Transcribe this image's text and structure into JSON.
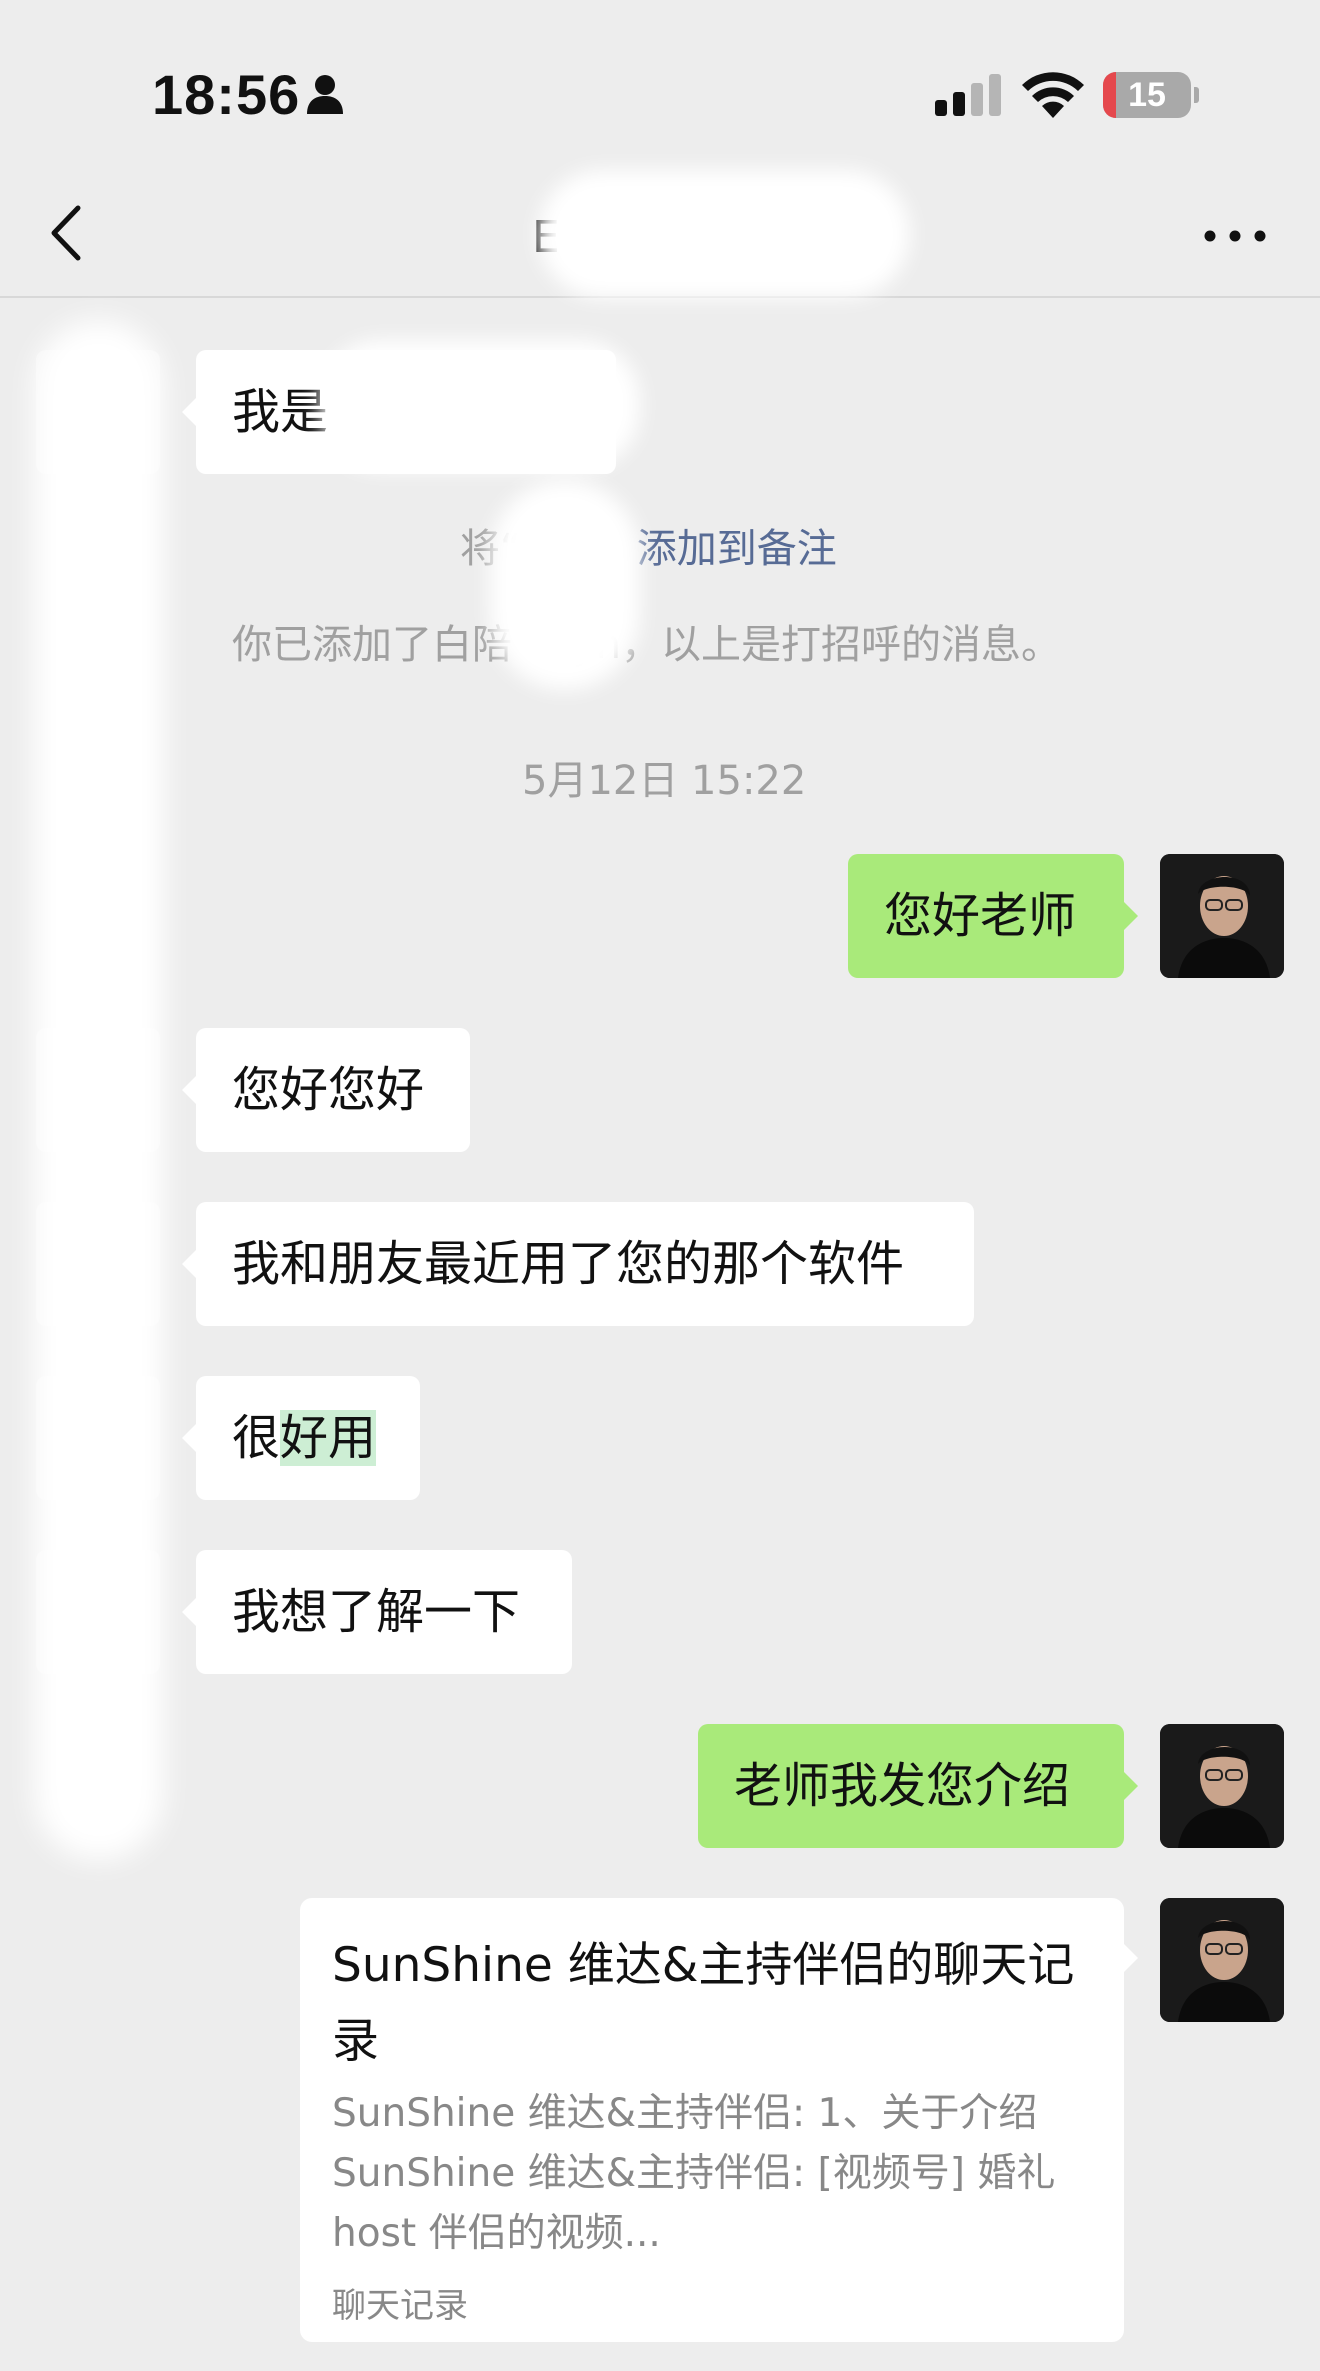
{
  "status_bar": {
    "time": "18:56",
    "battery": "15",
    "battery_level": 0.15
  },
  "header": {
    "back_icon": "chevron-left-icon",
    "title": "E",
    "more_icon": "more-dots-icon"
  },
  "messages": {
    "m1": "我是",
    "remark_prefix": "将“",
    "remark_link": "添加到备注",
    "added_notice": "你已添加了白陪",
    "added_notice_tail": "yn，以上是打招呼的消息。",
    "timestamp": "5月12日 15:22",
    "m2": "您好老师",
    "m3": "您好您好",
    "m4": "我和朋友最近用了您的那个软件",
    "m5_prefix": "很",
    "m5_highlight": "好用",
    "m6": "我想了解一下",
    "m7": "老师我发您介绍"
  },
  "record_card": {
    "title": "SunShine 维达&主持伴侣的聊天记录",
    "line1": "SunShine 维达&主持伴侣: 1、关于介绍",
    "line2": "SunShine 维达&主持伴侣: [视频号] 婚礼",
    "line3": "host 伴侣的视频...",
    "footer": "聊天记录"
  },
  "colors": {
    "background": "#ededed",
    "outgoing_bubble": "#a9ea7a",
    "incoming_bubble": "#ffffff",
    "link": "#576b95",
    "battery_low": "#e5484d"
  }
}
